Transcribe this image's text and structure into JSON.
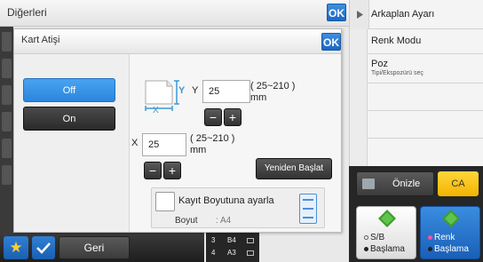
{
  "base": {
    "title": "Diğerleri",
    "ok_label": "OK",
    "back_label": "Geri",
    "trays": [
      {
        "num": "3",
        "size": "B4"
      },
      {
        "num": "4",
        "size": "A3"
      }
    ]
  },
  "right_panel": {
    "items": [
      {
        "label": "Arkaplan Ayarı",
        "sub": ""
      },
      {
        "label": "Renk Modu",
        "sub": ""
      },
      {
        "label": "Poz",
        "sub": "Tipi/Ekspozürü seç"
      }
    ],
    "preview_label": "Önizle",
    "ca_label": "CA",
    "start_bw": {
      "line1": "S/B",
      "line2": "Başlama"
    },
    "start_color": {
      "line1": "Renk",
      "line2": "Başlama"
    }
  },
  "dialog": {
    "title": "Kart Atişi",
    "ok_label": "OK",
    "off_label": "Off",
    "on_label": "On",
    "y_label": "Y",
    "y_value": "25",
    "y_range": "( 25~210 )",
    "y_unit": "mm",
    "x_label": "X",
    "x_value": "25",
    "x_range": "( 25~210 )",
    "x_unit": "mm",
    "minus": "−",
    "plus": "+",
    "restart_label": "Yeniden Başlat",
    "register_label": "Kayıt Boyutuna ayarla",
    "size_label": "Boyut",
    "size_value": ": A4",
    "icon_y": "Y",
    "icon_x": "X"
  },
  "colors": {
    "accent_blue": "#2a86dd",
    "ok_blue": "#1d67c4",
    "ca_yellow": "#f2b400",
    "start_green": "#5fc44a"
  }
}
